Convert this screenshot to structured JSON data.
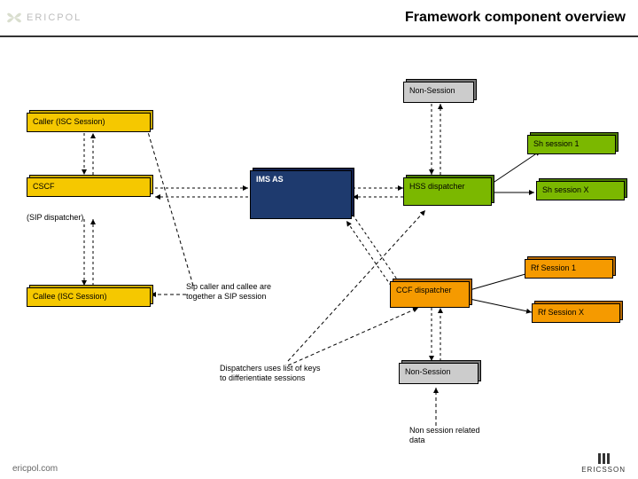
{
  "header": {
    "brand": "ERICPOL",
    "title": "Framework component overview"
  },
  "boxes": {
    "caller": "Caller (ISC Session)",
    "cscf": "CSCF",
    "sip_disp": "(SIP dispatcher)",
    "callee": "Callee (ISC Session)",
    "ims_as": "IMS AS",
    "non_session_top": "Non-Session",
    "hss": "HSS dispatcher",
    "sh1": "Sh session 1",
    "shx": "Sh session X",
    "ccf": "CCF dispatcher",
    "rf1": "Rf Session 1",
    "rfx": "Rf Session X",
    "non_session_bottom": "Non-Session"
  },
  "notes": {
    "sip_note": "Sip caller and callee are together a SIP session",
    "disp_note": "Dispatchers uses list of keys to differientiate sessions",
    "non_session_data": "Non session related data"
  },
  "footer": "ericpol.com",
  "ericsson": "ERICSSON"
}
